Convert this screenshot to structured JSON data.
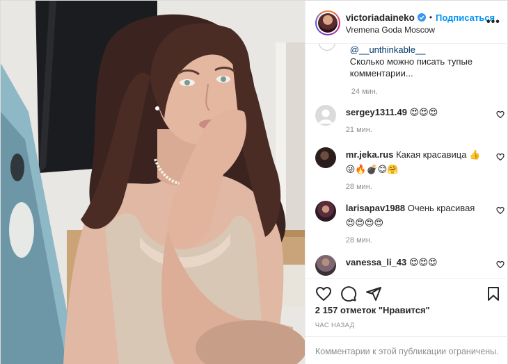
{
  "post": {
    "author": "victoriadaineko",
    "follow_label": "Подписаться",
    "dot": "•",
    "more": "•••",
    "location": "Vremena Goda Moscow",
    "photo_icon": "portrait-photo"
  },
  "reply": {
    "mention": "@__unthinkable__",
    "text": "Сколько можно писать тупые комментарии...",
    "time": "24 мин."
  },
  "comments": [
    {
      "user": "sergey1311.49",
      "text": "😍😍😍",
      "time": "21 мин."
    },
    {
      "user": "mr.jeka.rus",
      "text": "Какая красавица 👍 😜🔥💣😊🤗",
      "time": "28 мин."
    },
    {
      "user": "larisapav1988",
      "text": "Очень красивая 😍😍😍😍",
      "time": "28 мин."
    },
    {
      "user": "vanessa_li_43",
      "text": "😍😍😍",
      "time": ""
    }
  ],
  "actions": {
    "likes": "2 157 отметок \"Нравится\"",
    "posted": "ЧАС НАЗАД",
    "limited": "Комментарии к этой публикации ограничены."
  },
  "icons": [
    "verified-icon",
    "heart-icon",
    "comment-icon",
    "share-icon",
    "bookmark-icon",
    "more-icon"
  ],
  "colors": {
    "accent": "#0095f6",
    "muted": "#8e8e8e",
    "text": "#262626",
    "border": "#efefef"
  }
}
